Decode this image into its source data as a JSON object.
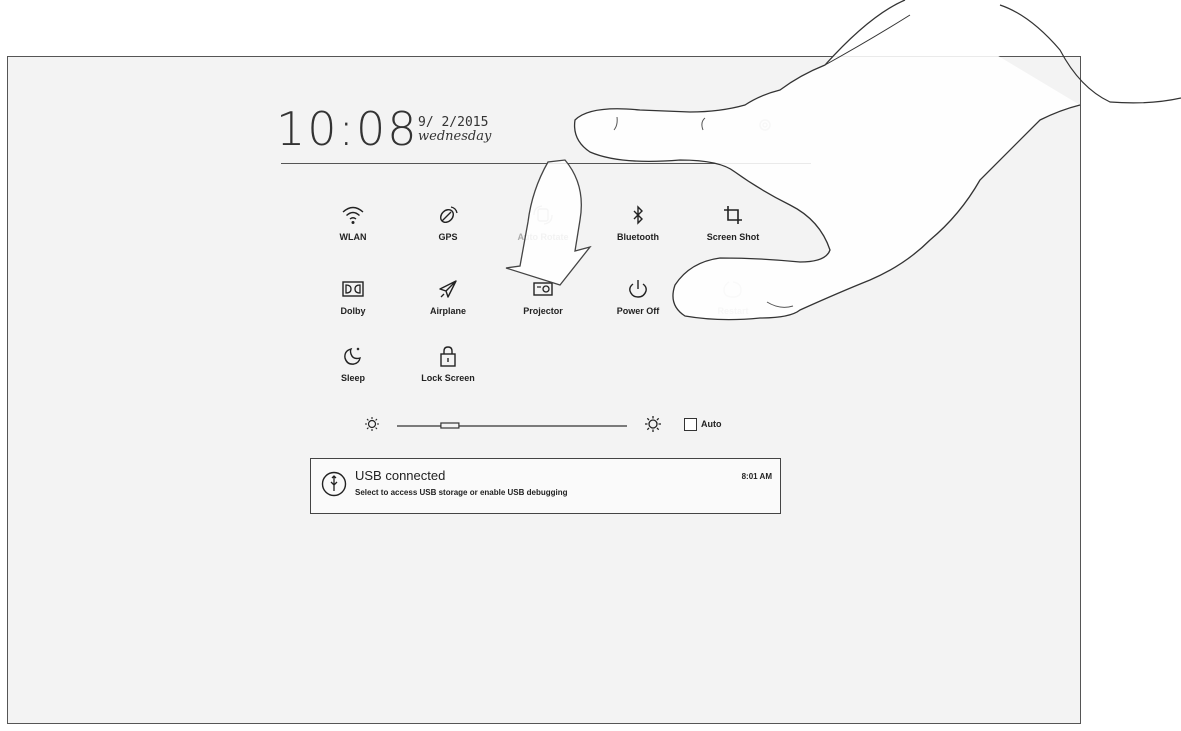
{
  "status": {
    "time": "10:08",
    "date": "9/ 2/2015",
    "weekday": "wednesday"
  },
  "quick_settings": [
    {
      "label": "WLAN",
      "icon": "wifi-icon"
    },
    {
      "label": "GPS",
      "icon": "gps-icon"
    },
    {
      "label": "Auto Rotate",
      "icon": "auto-rotate-icon"
    },
    {
      "label": "Bluetooth",
      "icon": "bluetooth-icon"
    },
    {
      "label": "Screen Shot",
      "icon": "screenshot-icon"
    },
    {
      "label": "Dolby",
      "icon": "dolby-icon"
    },
    {
      "label": "Airplane",
      "icon": "airplane-icon"
    },
    {
      "label": "Projector",
      "icon": "projector-icon"
    },
    {
      "label": "Power Off",
      "icon": "power-icon"
    },
    {
      "label": "Restart",
      "icon": "restart-icon"
    },
    {
      "label": "Sleep",
      "icon": "sleep-icon"
    },
    {
      "label": "Lock Screen",
      "icon": "lock-icon"
    }
  ],
  "brightness": {
    "level": 0.23,
    "auto_label": "Auto",
    "auto_checked": false
  },
  "notification": {
    "title": "USB connected",
    "subtitle": "Select to access USB storage or enable USB debugging",
    "time": "8:01 AM",
    "icon": "usb-icon"
  }
}
